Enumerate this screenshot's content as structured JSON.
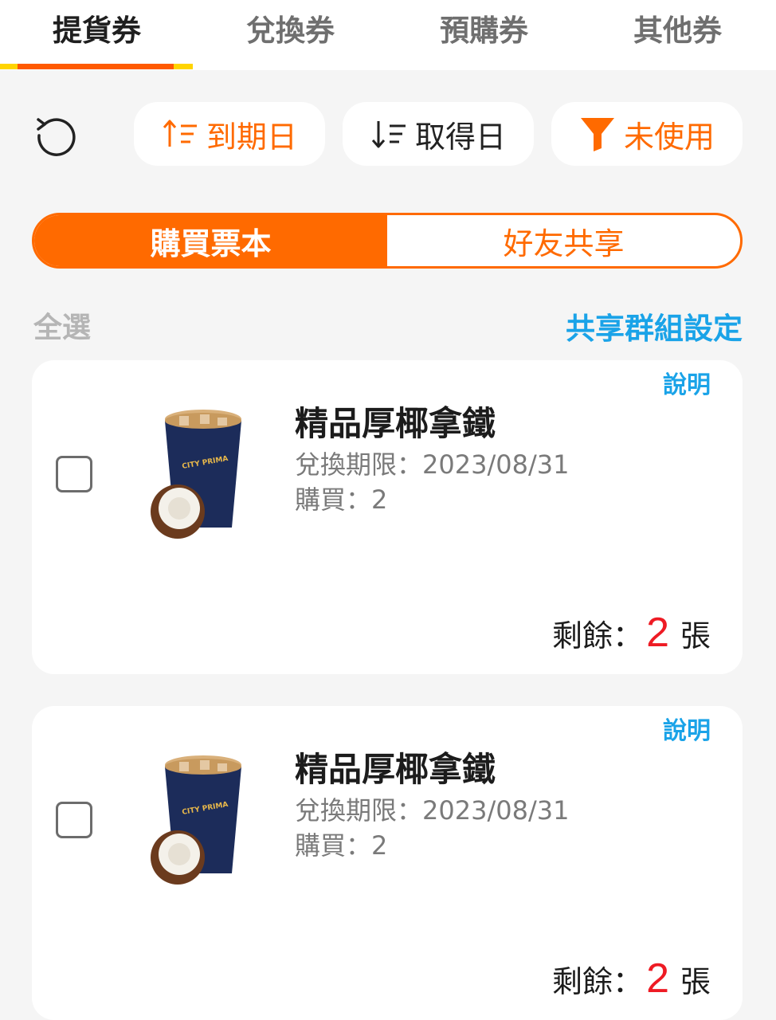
{
  "tabs": [
    {
      "label": "提貨券",
      "active": true
    },
    {
      "label": "兌換券",
      "active": false
    },
    {
      "label": "預購券",
      "active": false
    },
    {
      "label": "其他券",
      "active": false
    }
  ],
  "toolbar": {
    "refresh_icon": "refresh-icon",
    "sort_expire_label": "到期日",
    "sort_acquire_label": "取得日",
    "filter_label": "未使用"
  },
  "segment": {
    "purchased_label": "購買票本",
    "shared_label": "好友共享"
  },
  "list_header": {
    "select_all_label": "全選",
    "group_settings_label": "共享群組設定"
  },
  "colors": {
    "accent": "#ff6a00",
    "link": "#1aa3e8",
    "count": "#ee1b24"
  },
  "vouchers": [
    {
      "desc_label": "說明",
      "name": "精品厚椰拿鐵",
      "expire": "兌換期限：2023/08/31",
      "bought": "購買：2",
      "remain_prefix": "剩餘：",
      "remain_count": "2",
      "remain_unit": "張",
      "image_icon": "coffee-cup-coconut-image"
    },
    {
      "desc_label": "說明",
      "name": "精品厚椰拿鐵",
      "expire": "兌換期限：2023/08/31",
      "bought": "購買：2",
      "remain_prefix": "剩餘：",
      "remain_count": "2",
      "remain_unit": "張",
      "image_icon": "coffee-cup-coconut-image"
    }
  ]
}
